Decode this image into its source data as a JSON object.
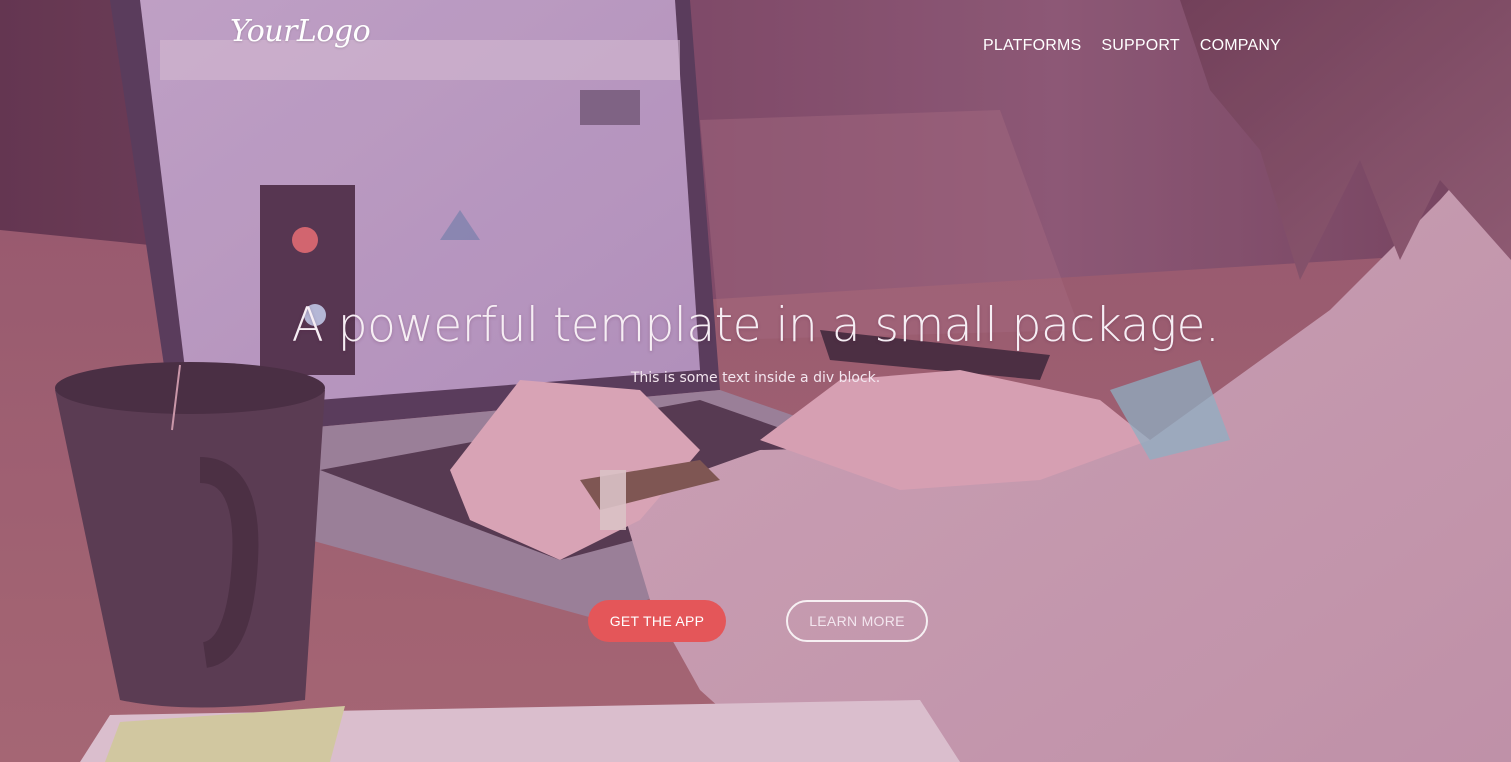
{
  "brand": {
    "logo_text": "YourLogo"
  },
  "nav": {
    "items": [
      {
        "label": "PLATFORMS"
      },
      {
        "label": "SUPPORT"
      },
      {
        "label": "COMPANY"
      }
    ]
  },
  "hero": {
    "headline": "A powerful template in a small package.",
    "subtext": "This is some text inside a div block.",
    "primary_button": "GET THE APP",
    "secondary_button": "LEARN MORE"
  },
  "colors": {
    "accent": "#e45659",
    "overlay_tint": "#8a5a76",
    "text": "#ffffff"
  }
}
